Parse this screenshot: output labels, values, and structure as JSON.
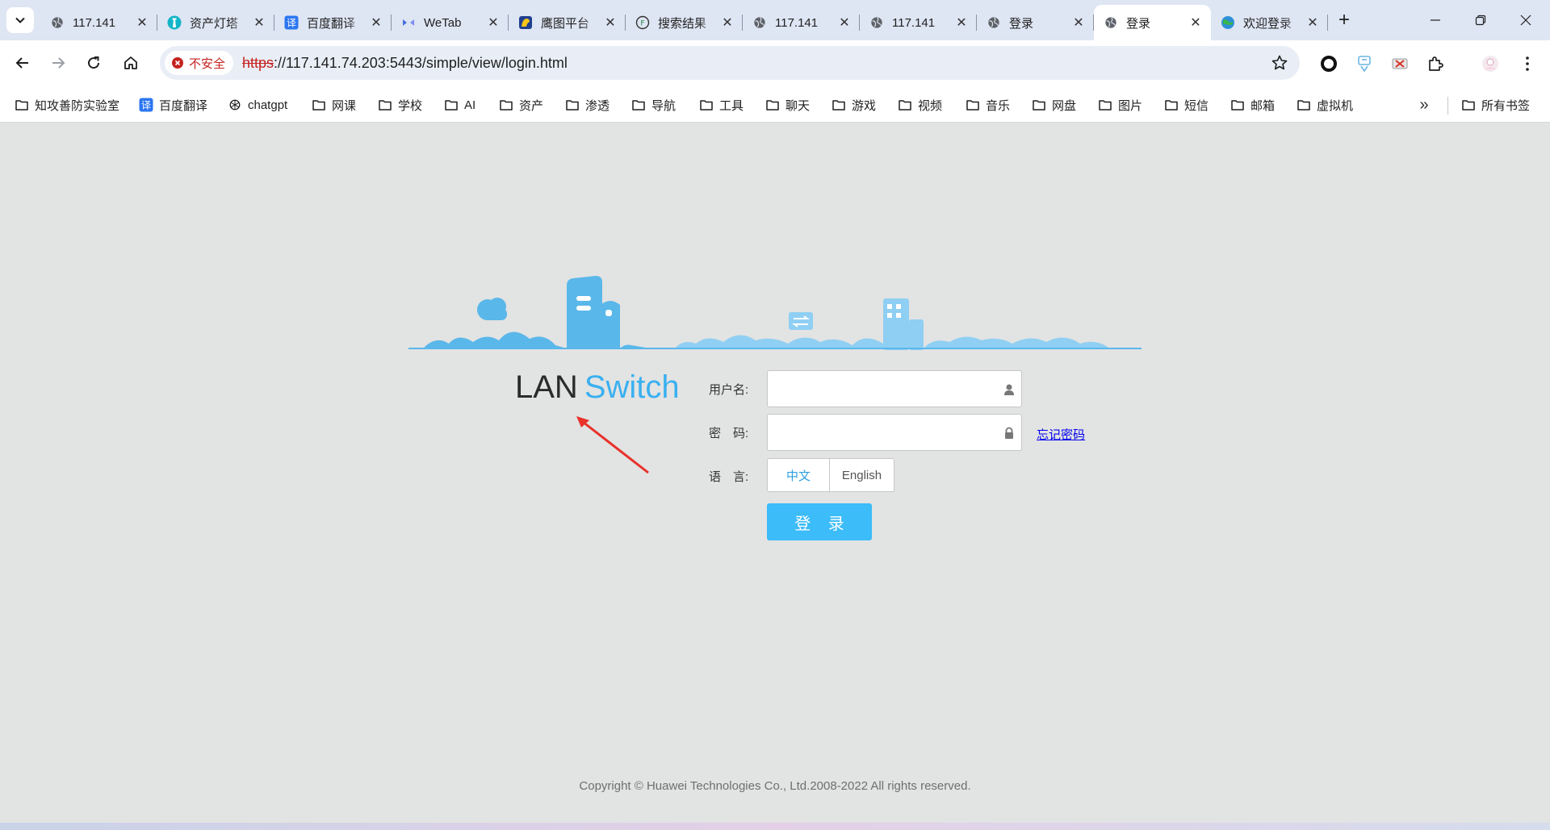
{
  "browser": {
    "tabs": [
      {
        "title": "117.141",
        "favicon": "globe-icon",
        "active": false
      },
      {
        "title": "资产灯塔",
        "favicon": "lighthouse-icon",
        "active": false
      },
      {
        "title": "百度翻译",
        "favicon": "baidu-translate-icon",
        "active": false
      },
      {
        "title": "WeTab",
        "favicon": "wetab-icon",
        "active": false
      },
      {
        "title": "鹰图平台",
        "favicon": "hunter-icon",
        "active": false
      },
      {
        "title": "搜索结果",
        "favicon": "fofa-icon",
        "active": false
      },
      {
        "title": "117.141",
        "favicon": "globe-icon",
        "active": false
      },
      {
        "title": "117.141",
        "favicon": "globe-icon",
        "active": false
      },
      {
        "title": "登录",
        "favicon": "globe-icon",
        "active": false
      },
      {
        "title": "登录",
        "favicon": "globe-icon",
        "active": true
      },
      {
        "title": "欢迎登录",
        "favicon": "earth-icon",
        "active": false
      }
    ],
    "address": {
      "security_label": "不安全",
      "scheme": "https",
      "rest": "://117.141.74.203:5443/simple/view/login.html"
    },
    "bookmarks": [
      {
        "label": "知攻善防实验室",
        "icon": "folder-icon"
      },
      {
        "label": "百度翻译",
        "icon": "baidu-translate-icon"
      },
      {
        "label": "chatgpt",
        "icon": "openai-icon"
      },
      {
        "label": "网课",
        "icon": "folder-icon"
      },
      {
        "label": "学校",
        "icon": "folder-icon"
      },
      {
        "label": "AI",
        "icon": "folder-icon"
      },
      {
        "label": "资产",
        "icon": "folder-icon"
      },
      {
        "label": "渗透",
        "icon": "folder-icon"
      },
      {
        "label": "导航",
        "icon": "folder-icon"
      },
      {
        "label": "工具",
        "icon": "folder-icon"
      },
      {
        "label": "聊天",
        "icon": "folder-icon"
      },
      {
        "label": "游戏",
        "icon": "folder-icon"
      },
      {
        "label": "视频",
        "icon": "folder-icon"
      },
      {
        "label": "音乐",
        "icon": "folder-icon"
      },
      {
        "label": "网盘",
        "icon": "folder-icon"
      },
      {
        "label": "图片",
        "icon": "folder-icon"
      },
      {
        "label": "短信",
        "icon": "folder-icon"
      },
      {
        "label": "邮箱",
        "icon": "folder-icon"
      },
      {
        "label": "虚拟机",
        "icon": "folder-icon"
      }
    ],
    "all_bookmarks_label": "所有书签"
  },
  "login": {
    "product_lan": "LAN",
    "product_switch": "Switch",
    "username_label": "用户名:",
    "password_label": "密　码:",
    "language_label": "语　言:",
    "username_value": "",
    "password_value": "",
    "forgot_password": "忘记密码",
    "lang_zh": "中文",
    "lang_en": "English",
    "login_button": "登 录",
    "copyright": "Copyright © Huawei Technologies Co., Ltd.2008-2022 All rights reserved."
  },
  "colors": {
    "accent": "#3cbcf8",
    "banner": "#5ab7ea",
    "insecure": "#c5221f"
  }
}
